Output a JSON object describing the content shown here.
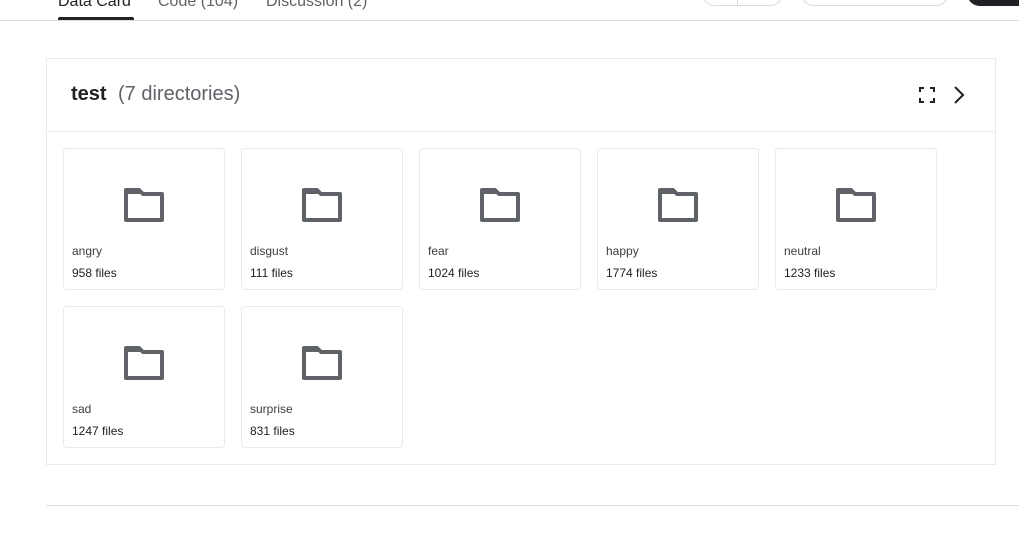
{
  "tabs": [
    {
      "label": "Data Card"
    },
    {
      "label": "Code (104)"
    },
    {
      "label": "Discussion (2)"
    }
  ],
  "panel": {
    "title": "test",
    "count": "(7 directories)",
    "expand_icon": "fullscreen-icon",
    "next_icon": "chevron-right-icon"
  },
  "folders": [
    {
      "name": "angry",
      "files": "958 files"
    },
    {
      "name": "disgust",
      "files": "111 files"
    },
    {
      "name": "fear",
      "files": "1024 files"
    },
    {
      "name": "happy",
      "files": "1774 files"
    },
    {
      "name": "neutral",
      "files": "1233 files"
    },
    {
      "name": "sad",
      "files": "1247 files"
    },
    {
      "name": "surprise",
      "files": "831 files"
    }
  ],
  "colors": {
    "folder_icon": "#5f6368",
    "border": "#e8eaed",
    "text_primary": "#202124",
    "text_secondary": "#5f6368"
  }
}
